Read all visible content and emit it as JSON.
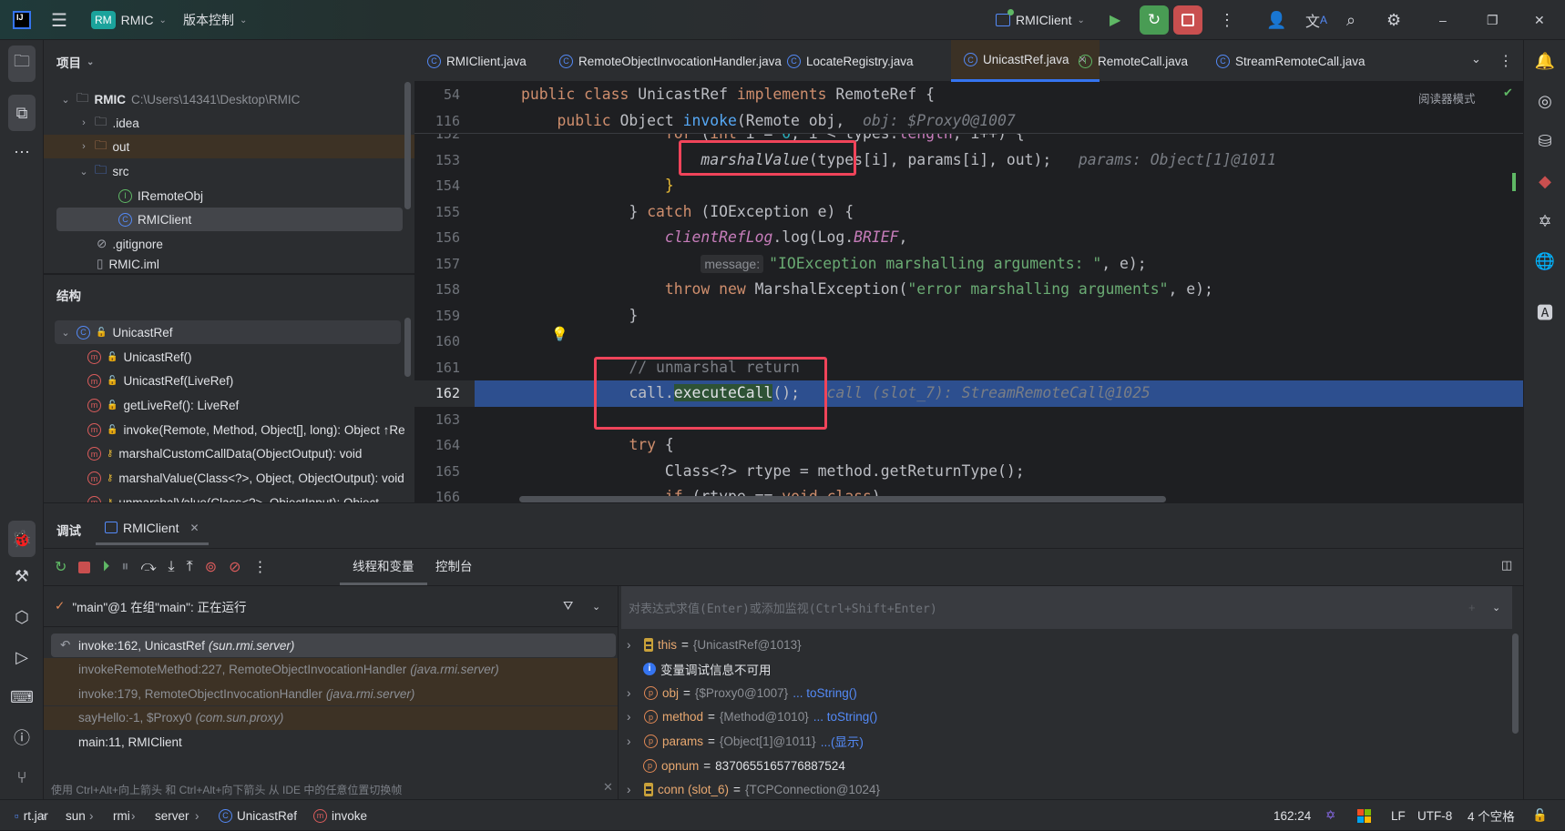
{
  "titlebar": {
    "project_badge": "RM",
    "project": "RMIC",
    "vcs": "版本控制",
    "run_config": "RMIClient"
  },
  "tabs": [
    {
      "label": "RMIClient.java",
      "icon": "class-run-icon"
    },
    {
      "label": "RemoteObjectInvocationHandler.java",
      "icon": "class-icon"
    },
    {
      "label": "LocateRegistry.java",
      "icon": "class-icon"
    },
    {
      "label": "UnicastRef.java",
      "icon": "class-icon",
      "active": true
    },
    {
      "label": "RemoteCall.java",
      "icon": "interface-icon"
    },
    {
      "label": "StreamRemoteCall.java",
      "icon": "class-icon"
    }
  ],
  "project_panel": {
    "title": "项目",
    "root": {
      "label": "RMIC",
      "path": "C:\\Users\\14341\\Desktop\\RMIC"
    },
    "items": [
      {
        "label": ".idea"
      },
      {
        "label": "out"
      },
      {
        "label": "src"
      },
      {
        "label": "IRemoteObj"
      },
      {
        "label": "RMIClient"
      },
      {
        "label": ".gitignore"
      },
      {
        "label": "RMIC.iml"
      }
    ]
  },
  "structure": {
    "title": "结构",
    "class": "UnicastRef",
    "members": [
      "UnicastRef()",
      "UnicastRef(LiveRef)",
      "getLiveRef(): LiveRef",
      "invoke(Remote, Method, Object[], long): Object ↑Re",
      "marshalCustomCallData(ObjectOutput): void",
      "marshalValue(Class<?>, Object, ObjectOutput): void",
      "unmarshalValue(Class<?>, ObjectInput): Object"
    ]
  },
  "editor": {
    "reader_mode": "阅读器模式",
    "sticky": [
      {
        "num": "54",
        "indent": 0,
        "tokens": [
          [
            "kw",
            "public class "
          ],
          [
            "p",
            "UnicastRef "
          ],
          [
            "kw",
            "implements "
          ],
          [
            "p",
            "RemoteRef {"
          ]
        ]
      },
      {
        "num": "116",
        "indent": 4,
        "tokens": [
          [
            "kw",
            "public "
          ],
          [
            "p",
            "Object "
          ],
          [
            "fn",
            "invoke"
          ],
          [
            "p",
            "(Remote obj,"
          ],
          [
            "hint",
            "  obj: $Proxy0@1007"
          ]
        ]
      }
    ],
    "lines": [
      {
        "num": "152",
        "indent": 16,
        "tokens": [
          [
            "kw",
            "for"
          ],
          [
            "p",
            " ("
          ],
          [
            "kw",
            "int"
          ],
          [
            "p",
            " i = "
          ],
          [
            "num",
            "0"
          ],
          [
            "p",
            "; i < types."
          ],
          [
            "fld",
            "length"
          ],
          [
            "p",
            "; i++) {"
          ]
        ]
      },
      {
        "num": "153",
        "indent": 20,
        "tokens": [
          [
            "it",
            "marshalValue"
          ],
          [
            "p",
            "(types[i], params[i], out);"
          ],
          [
            "hint",
            "   params: Object[1]@1011"
          ]
        ]
      },
      {
        "num": "154",
        "indent": 16,
        "tokens": [
          [
            "by",
            "}"
          ]
        ]
      },
      {
        "num": "155",
        "indent": 12,
        "tokens": [
          [
            "p",
            "} "
          ],
          [
            "kw",
            "catch"
          ],
          [
            "p",
            " (IOException e) {"
          ]
        ]
      },
      {
        "num": "156",
        "indent": 16,
        "tokens": [
          [
            "st",
            "clientRefLog"
          ],
          [
            "p",
            ".log(Log."
          ],
          [
            "st",
            "BRIEF"
          ],
          [
            "p",
            ","
          ]
        ]
      },
      {
        "num": "157",
        "indent": 20,
        "tokens": [
          [
            "inlay",
            "message:"
          ],
          [
            "str",
            "\"IOException marshalling arguments: \""
          ],
          [
            "p",
            ", e);"
          ]
        ]
      },
      {
        "num": "158",
        "indent": 16,
        "tokens": [
          [
            "kw",
            "throw new "
          ],
          [
            "p",
            "MarshalException("
          ],
          [
            "str",
            "\"error marshalling arguments\""
          ],
          [
            "p",
            ", e);"
          ]
        ]
      },
      {
        "num": "159",
        "indent": 12,
        "tokens": [
          [
            "p",
            "}"
          ]
        ]
      },
      {
        "num": "160",
        "indent": 0,
        "tokens": []
      },
      {
        "num": "161",
        "indent": 12,
        "tokens": [
          [
            "cmt",
            "// unmarshal return"
          ]
        ]
      },
      {
        "num": "162",
        "indent": 12,
        "current": true,
        "tokens": [
          [
            "p",
            "call."
          ],
          [
            "hlw",
            "executeCall"
          ],
          [
            "p",
            "();"
          ],
          [
            "hint",
            "   call (slot_7): StreamRemoteCall@1025"
          ]
        ]
      },
      {
        "num": "163",
        "indent": 0,
        "tokens": []
      },
      {
        "num": "164",
        "indent": 12,
        "tokens": [
          [
            "kw",
            "try"
          ],
          [
            "p",
            " {"
          ]
        ]
      },
      {
        "num": "165",
        "indent": 16,
        "tokens": [
          [
            "p",
            "Class<?> rtype = method.getReturnType();"
          ]
        ]
      },
      {
        "num": "166",
        "indent": 16,
        "tokens": [
          [
            "kw",
            "if"
          ],
          [
            "p",
            " (rtype == "
          ],
          [
            "kw",
            "void"
          ],
          [
            "p",
            "."
          ],
          [
            "kw",
            "class"
          ],
          [
            "p",
            ")"
          ]
        ]
      }
    ]
  },
  "debug": {
    "title": "调试",
    "session": "RMIClient",
    "subtabs": [
      "线程和变量",
      "控制台"
    ],
    "thread": "\"main\"@1 在组\"main\": 正在运行",
    "frames": [
      {
        "method": "invoke:162, UnicastRef",
        "pkg": "(sun.rmi.server)",
        "selected": true
      },
      {
        "method": "invokeRemoteMethod:227, RemoteObjectInvocationHandler",
        "pkg": "(java.rmi.server)",
        "library": true
      },
      {
        "method": "invoke:179, RemoteObjectInvocationHandler",
        "pkg": "(java.rmi.server)",
        "library": true
      },
      {
        "method": "sayHello:-1, $Proxy0",
        "pkg": "(com.sun.proxy)",
        "library": true
      },
      {
        "method": "main:11, RMIClient",
        "pkg": ""
      }
    ],
    "hint": "使用 Ctrl+Alt+向上箭头 和 Ctrl+Alt+向下箭头 从 IDE 中的任意位置切换帧",
    "eval_placeholder": "对表达式求值(Enter)或添加监视(Ctrl+Shift+Enter)",
    "variables": [
      {
        "name": "this",
        "value": "{UnicastRef@1013}",
        "kind": "field",
        "expand": true
      },
      {
        "name": "变量调试信息不可用",
        "kind": "info"
      },
      {
        "name": "obj",
        "value": "{$Proxy0@1007}",
        "link": "... toString()",
        "kind": "param",
        "expand": true
      },
      {
        "name": "method",
        "value": "{Method@1010}",
        "link": "... toString()",
        "kind": "param",
        "expand": true
      },
      {
        "name": "params",
        "value": "{Object[1]@1011}",
        "link": "...(显示)",
        "kind": "param",
        "expand": true
      },
      {
        "name": "opnum",
        "value": "8370655165776887524",
        "kind": "param",
        "plain": true
      },
      {
        "name": "conn (slot_6)",
        "value": "{TCPConnection@1024}",
        "kind": "field",
        "expand": true
      }
    ]
  },
  "statusbar": {
    "breadcrumbs": [
      "rt.jar",
      "sun",
      "rmi",
      "server",
      "UnicastRef",
      "invoke"
    ],
    "position": "162:24",
    "line_sep": "LF",
    "encoding": "UTF-8",
    "indent": "4 个空格"
  },
  "colors": {
    "accent": "#3574f0",
    "breakpoint_line": "#2d4f8f",
    "highlight_box": "#f0445a",
    "library_frame": "#3d3225"
  }
}
